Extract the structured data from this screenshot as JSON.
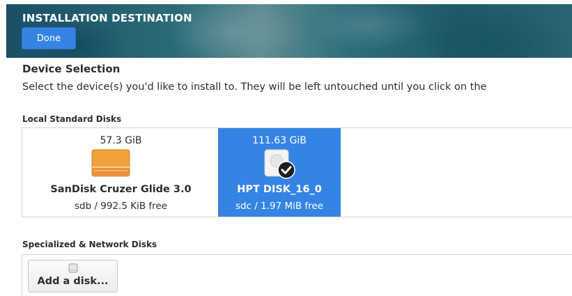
{
  "header": {
    "title": "INSTALLATION DESTINATION",
    "done_label": "Done"
  },
  "device_selection": {
    "title": "Device Selection",
    "description": "Select the device(s) you'd like to install to.  They will be left untouched until you click on the"
  },
  "local_disks": {
    "heading": "Local Standard Disks",
    "disks": [
      {
        "size": "57.3 GiB",
        "name": "SanDisk Cruzer Glide 3.0",
        "info": "sdb  /  992.5 KiB free",
        "icon": "usb-drive-icon",
        "selected": false
      },
      {
        "size": "111.63 GiB",
        "name": "HPT DISK_16_0",
        "info": "sdc / 1.97 MiB free",
        "icon": "hard-disk-icon",
        "selected": true
      }
    ]
  },
  "specialized": {
    "heading": "Specialized & Network Disks",
    "add_disk_label": "Add a disk..."
  },
  "colors": {
    "accent": "#3584e4",
    "usb_orange": "#f0a13a"
  }
}
